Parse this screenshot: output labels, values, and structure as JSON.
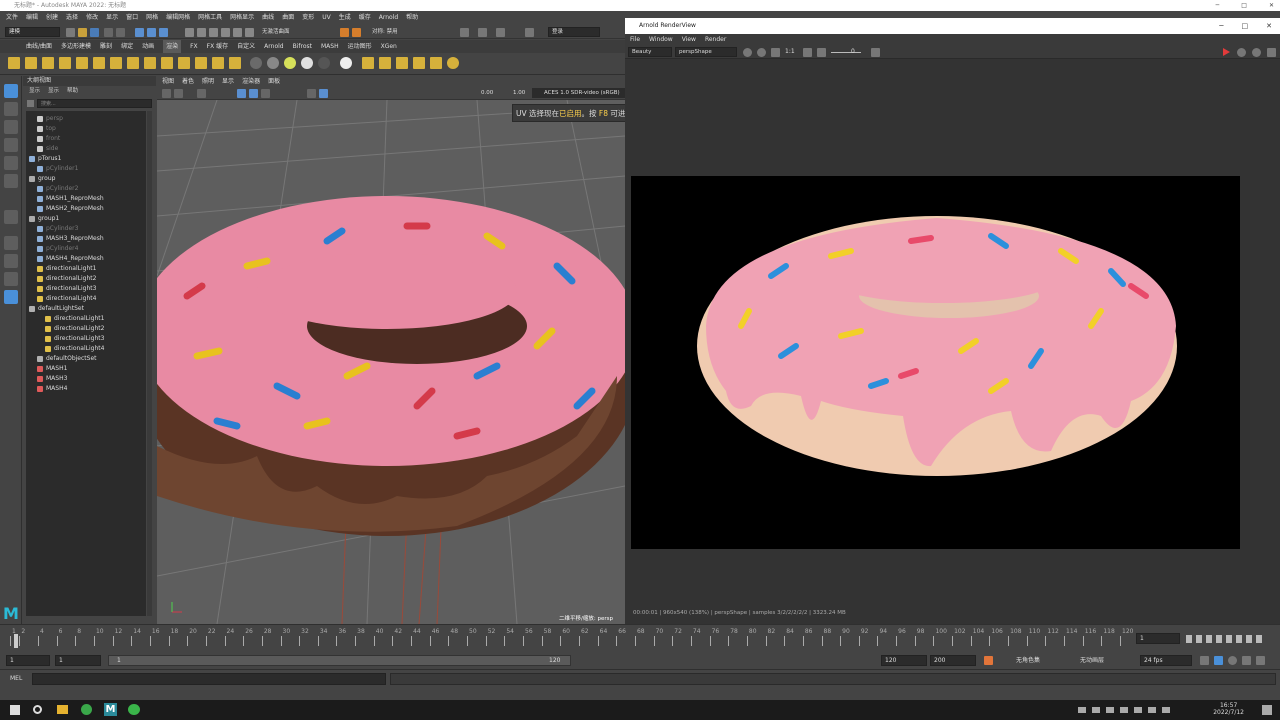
{
  "window": {
    "title": "无标题* - Autodesk MAYA 2022: 无标题",
    "ctl_min": "─",
    "ctl_max": "□",
    "ctl_close": "✕"
  },
  "menubar": [
    "文件",
    "编辑",
    "创建",
    "选择",
    "修改",
    "显示",
    "窗口",
    "网格",
    "编辑网格",
    "网格工具",
    "网格显示",
    "曲线",
    "曲面",
    "变形",
    "UV",
    "生成",
    "缓存",
    "Arnold",
    "帮助"
  ],
  "statusline": {
    "menuset": "建模",
    "live_label": "无激活曲面",
    "symmetry": "对称: 禁用",
    "login": "登录"
  },
  "shelf_tabs": [
    "曲线/曲面",
    "多边形建模",
    "雕刻",
    "绑定",
    "动画",
    "渲染",
    "FX",
    "FX 缓存",
    "自定义",
    "Arnold",
    "Bifrost",
    "MASH",
    "运动图形",
    "XGen"
  ],
  "shelf_active": 5,
  "outliner": {
    "title": "大纲视图",
    "menus": [
      "显示",
      "显示",
      "帮助"
    ],
    "search_placeholder": "搜索...",
    "items": [
      {
        "label": "persp",
        "dim": true,
        "indent": 1,
        "icon": "camera-icon"
      },
      {
        "label": "top",
        "dim": true,
        "indent": 1,
        "icon": "camera-icon"
      },
      {
        "label": "front",
        "dim": true,
        "indent": 1,
        "icon": "camera-icon"
      },
      {
        "label": "side",
        "dim": true,
        "indent": 1,
        "icon": "camera-icon"
      },
      {
        "label": "pTorus1",
        "dim": false,
        "indent": 0,
        "icon": "mesh-icon"
      },
      {
        "label": "pCylinder1",
        "dim": true,
        "indent": 1,
        "icon": "mesh-icon"
      },
      {
        "label": "group",
        "dim": false,
        "indent": 0,
        "icon": "group-icon"
      },
      {
        "label": "pCylinder2",
        "dim": true,
        "indent": 1,
        "icon": "mesh-icon"
      },
      {
        "label": "MASH1_ReproMesh",
        "dim": false,
        "indent": 1,
        "icon": "mesh-icon"
      },
      {
        "label": "MASH2_ReproMesh",
        "dim": false,
        "indent": 1,
        "icon": "mesh-icon"
      },
      {
        "label": "group1",
        "dim": false,
        "indent": 0,
        "icon": "group-icon"
      },
      {
        "label": "pCylinder3",
        "dim": true,
        "indent": 1,
        "icon": "mesh-icon"
      },
      {
        "label": "MASH3_ReproMesh",
        "dim": false,
        "indent": 1,
        "icon": "mesh-icon"
      },
      {
        "label": "pCylinder4",
        "dim": true,
        "indent": 1,
        "icon": "mesh-icon"
      },
      {
        "label": "MASH4_ReproMesh",
        "dim": false,
        "indent": 1,
        "icon": "mesh-icon"
      },
      {
        "label": "directionalLight1",
        "dim": false,
        "indent": 1,
        "icon": "light-icon"
      },
      {
        "label": "directionalLight2",
        "dim": false,
        "indent": 1,
        "icon": "light-icon"
      },
      {
        "label": "directionalLight3",
        "dim": false,
        "indent": 1,
        "icon": "light-icon"
      },
      {
        "label": "directionalLight4",
        "dim": false,
        "indent": 1,
        "icon": "light-icon"
      },
      {
        "label": "defaultLightSet",
        "dim": false,
        "indent": 0,
        "icon": "set-icon"
      },
      {
        "label": "directionalLight1",
        "dim": false,
        "indent": 2,
        "icon": "light-icon"
      },
      {
        "label": "directionalLight2",
        "dim": false,
        "indent": 2,
        "icon": "light-icon"
      },
      {
        "label": "directionalLight3",
        "dim": false,
        "indent": 2,
        "icon": "light-icon"
      },
      {
        "label": "directionalLight4",
        "dim": false,
        "indent": 2,
        "icon": "light-icon"
      },
      {
        "label": "defaultObjectSet",
        "dim": false,
        "indent": 1,
        "icon": "set-icon"
      },
      {
        "label": "MASH1",
        "dim": false,
        "indent": 1,
        "icon": "mash-icon"
      },
      {
        "label": "MASH3",
        "dim": false,
        "indent": 1,
        "icon": "mash-icon"
      },
      {
        "label": "MASH4",
        "dim": false,
        "indent": 1,
        "icon": "mash-icon"
      }
    ]
  },
  "viewport": {
    "menus": [
      "视图",
      "着色",
      "照明",
      "显示",
      "渲染器",
      "面板"
    ],
    "exposure": "0.00",
    "gamma": "1.00",
    "colorspace": "ACES 1.0 SDR-video (sRGB)",
    "camera_label": "二维平移/缩放: persp",
    "uv_tip_a": "UV 选择现在",
    "uv_tip_b": "已启用",
    "uv_tip_c": "。按",
    "uv_tip_d": "F8",
    "uv_tip_e": "可进行对象选择"
  },
  "renderview": {
    "title": "Arnold RenderView",
    "menus": [
      "File",
      "Window",
      "View",
      "Render"
    ],
    "aov": "Beauty",
    "camera": "perspShape",
    "ratio": "1:1",
    "exposure": "0",
    "status": "00:00:01 | 960x540 (138%) | perspShape | samples 3/2/2/2/2/2 | 3323.24 MB"
  },
  "timeline": {
    "ticks": [
      1,
      2,
      4,
      6,
      8,
      10,
      12,
      14,
      16,
      18,
      20,
      22,
      24,
      26,
      28,
      30,
      32,
      34,
      36,
      38,
      40,
      42,
      44,
      46,
      48,
      50,
      52,
      54,
      56,
      58,
      60,
      62,
      64,
      66,
      68,
      70,
      72,
      74,
      76,
      78,
      80,
      82,
      84,
      86,
      88,
      90,
      92,
      94,
      96,
      98,
      100,
      102,
      104,
      106,
      108,
      110,
      112,
      114,
      116,
      118,
      120
    ],
    "current_frame": "1"
  },
  "range": {
    "start": "1",
    "inner_start": "1",
    "slider_start": "1",
    "slider_end": "120",
    "end": "120",
    "max": "200",
    "character_set": "无角色集",
    "anim_layer": "无动画层",
    "fps": "24 fps"
  },
  "cmdline": {
    "label": "MEL"
  },
  "taskbar": {
    "time": "16:57",
    "date": "2022/7/12"
  },
  "colors": {
    "maya_bg": "#444444",
    "field": "#2b2b2b",
    "viewport": "#5e5e5e",
    "frosting": "#e88aa3",
    "dough": "#6e4530",
    "highlight": "#4a90d9"
  }
}
